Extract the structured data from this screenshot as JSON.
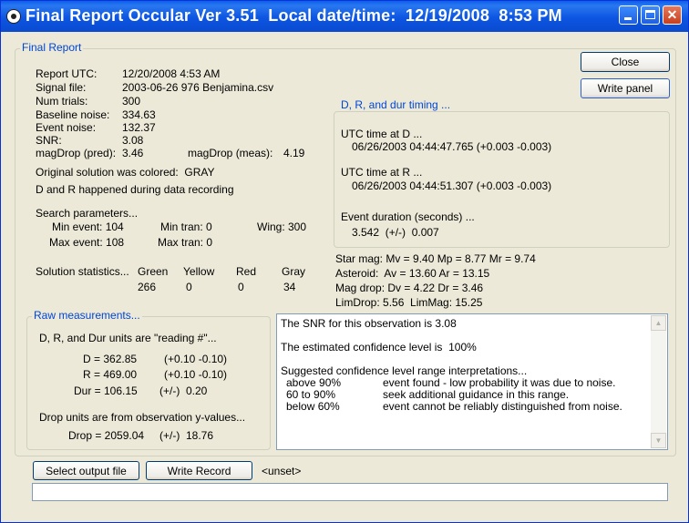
{
  "window": {
    "title": "Final Report Occular Ver 3.51  Local date/time:  12/19/2008  8:53 PM"
  },
  "titlebar": {
    "minimize_icon": "minimize-icon",
    "maximize_icon": "maximize-icon",
    "close_glyph": "✕"
  },
  "final_report": {
    "group_title": "Final Report",
    "report_utc_label": "Report UTC:",
    "report_utc": "12/20/2008 4:53 AM",
    "signal_file_label": "Signal file:",
    "signal_file": "2003-06-26 976 Benjamina.csv",
    "num_trials_label": "Num trials:",
    "num_trials": "300",
    "baseline_noise_label": "Baseline noise:",
    "baseline_noise": "334.63",
    "event_noise_label": "Event noise:",
    "event_noise": "132.37",
    "snr_label": "SNR:",
    "snr": "3.08",
    "magdrop_pred_label": "magDrop (pred):",
    "magdrop_pred": "3.46",
    "magdrop_meas_label": "magDrop (meas):",
    "magdrop_meas": "4.19",
    "colored_line": "Original solution was colored:  GRAY",
    "dr_line": "D and R happened during data recording",
    "search_params_label": "Search parameters...",
    "min_event": "Min event: 104",
    "min_tran": "Min tran: 0",
    "wing": "Wing: 300",
    "max_event": "Max event: 108",
    "max_tran": "Max tran: 0",
    "sol_stats_label": "Solution statistics...",
    "stat_headers": [
      "Green",
      "Yellow",
      "Red",
      "Gray"
    ],
    "stat_values": [
      "266",
      "0",
      "0",
      "34"
    ]
  },
  "buttons": {
    "close": "Close",
    "write_panel": "Write panel",
    "select_output": "Select output file",
    "write_record": "Write Record"
  },
  "timing": {
    "group_title": "D, R, and dur timing ...",
    "d_label": "UTC time at D ...",
    "d_value": "06/26/2003 04:44:47.765 (+0.003 -0.003)",
    "r_label": "UTC time at R ...",
    "r_value": "06/26/2003 04:44:51.307 (+0.003 -0.003)",
    "dur_label": "Event duration (seconds) ...",
    "dur_value": "3.542  (+/-)  0.007"
  },
  "star": {
    "star_mag": "Star mag: Mv = 9.40 Mp = 8.77 Mr = 9.74",
    "asteroid": "Asteroid:  Av = 13.60 Ar = 13.15",
    "mag_drop": "Mag drop: Dv = 4.22 Dr = 3.46",
    "limdrop": "LimDrop: 5.56  LimMag: 15.25"
  },
  "raw": {
    "group_title": "Raw measurements...",
    "units_line": "D, R, and Dur units are \"reading #\"...",
    "d_eq": "D = 362.85",
    "d_err": "(+0.10 -0.10)",
    "r_eq": "R = 469.00",
    "r_err": "(+0.10 -0.10)",
    "dur_eq": "Dur = 106.15",
    "dur_err": "(+/-)  0.20",
    "drop_units": "Drop units are from observation y-values...",
    "drop_eq": "Drop = 2059.04",
    "drop_err": "(+/-)  18.76"
  },
  "notes": {
    "line1": "The SNR for this observation is 3.08",
    "line2": "The estimated confidence level is  100%",
    "line3": "Suggested confidence level range interpretations...",
    "rows": [
      {
        "range": "above 90%",
        "desc": "event found - low probability it was due to noise."
      },
      {
        "range": "60 to 90%",
        "desc": "seek additional guidance in this range."
      },
      {
        "range": "below 60%",
        "desc": "event cannot be reliably distinguished from noise."
      }
    ],
    "up_arrow": "▲",
    "down_arrow": "▼"
  },
  "output": {
    "path_label": "<unset>",
    "path_field": ""
  }
}
